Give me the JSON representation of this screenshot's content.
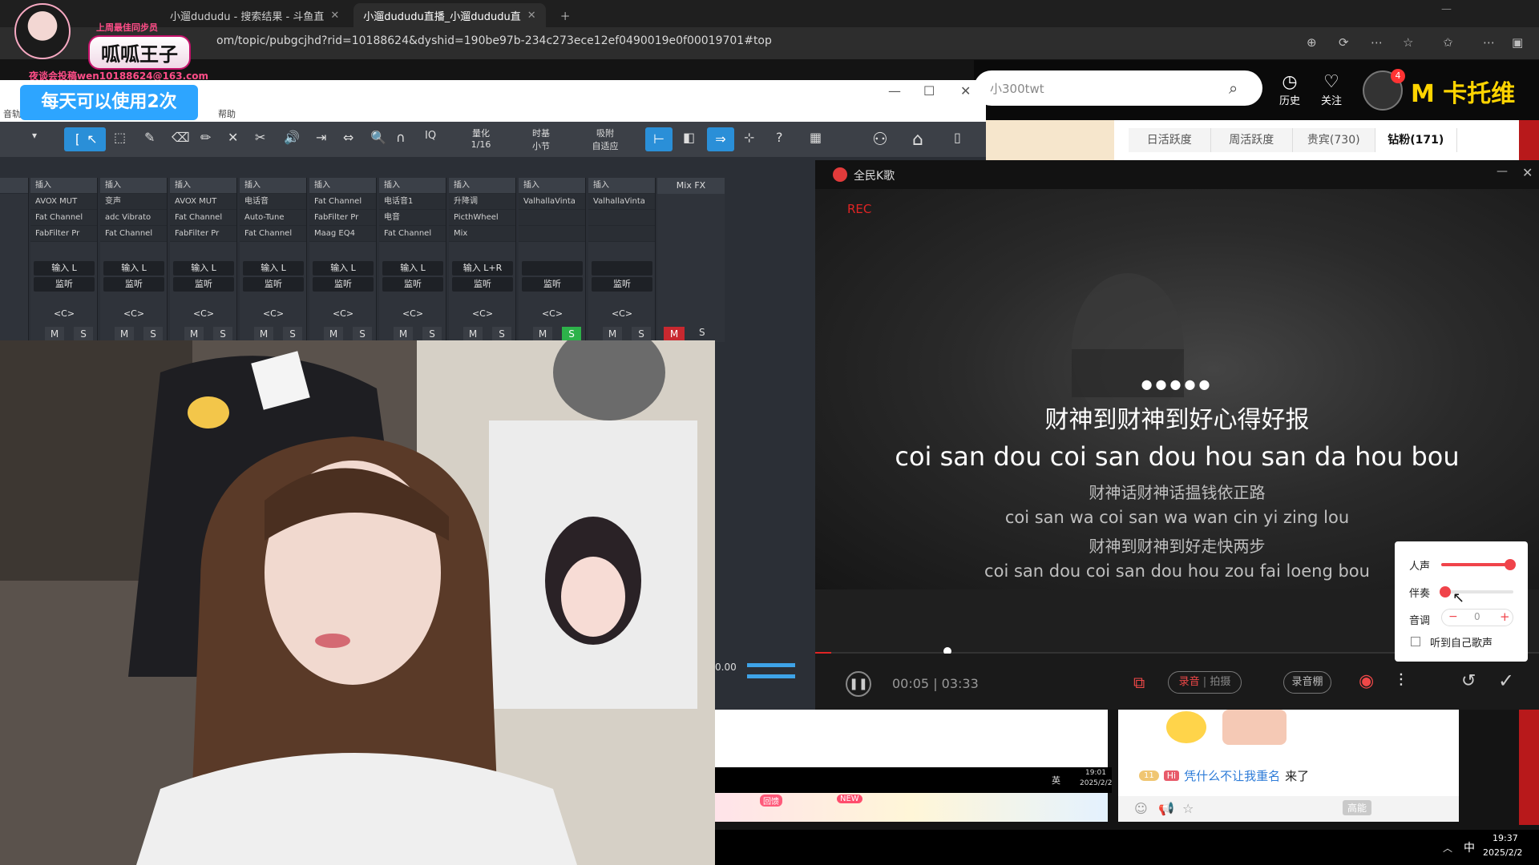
{
  "browser": {
    "tabs": [
      {
        "title": "小遛dududu - 搜索结果 - 斗鱼直"
      },
      {
        "title": "小遛dududu直播_小遛dududu直"
      }
    ],
    "url": "om/topic/pubgcjhd?rid=10188624&dyshid=190be97b-234c273ece12ef0490019e0f00019701#top"
  },
  "watermark": {
    "name": "呱呱王子",
    "subtitle": "上周最佳同步员",
    "email": "夜谈会投稿wen10188624@163.com"
  },
  "site_header": {
    "search_placeholder": "小300twt",
    "history": "历史",
    "follow": "关注",
    "avatar_badge": "4",
    "username": "M 卡托维"
  },
  "rank_tabs": [
    "日活跃度",
    "周活跃度",
    "贵宾(730)",
    "钻粉(171)"
  ],
  "daw": {
    "banner": "每天可以使用2次",
    "menu": [
      "音轨",
      "帮助"
    ],
    "toolbar": {
      "quantize_label": "量化",
      "quantize_value": "1/16",
      "timebase_label": "时基",
      "timebase_value": "小节",
      "snap_label": "吸附",
      "snap_value": "自适应"
    },
    "strips": [
      {
        "ins": "插入",
        "slots": [
          "AVOX MUT",
          "Fat Channel",
          "FabFilter Pr"
        ],
        "io": "输入 L",
        "mon": "监听",
        "pan": "<C>",
        "m": "M",
        "s": "S"
      },
      {
        "ins": "插入",
        "slots": [
          "变声",
          "adc Vibrato",
          "Fat Channel"
        ],
        "io": "输入 L",
        "mon": "监听",
        "pan": "<C>",
        "m": "M",
        "s": "S"
      },
      {
        "ins": "插入",
        "slots": [
          "AVOX MUT",
          "Fat Channel",
          "FabFilter Pr"
        ],
        "io": "输入 L",
        "mon": "监听",
        "pan": "<C>",
        "m": "M",
        "s": "S"
      },
      {
        "ins": "插入",
        "slots": [
          "电话音",
          "Auto-Tune",
          "Fat Channel"
        ],
        "io": "输入 L",
        "mon": "监听",
        "pan": "<C>",
        "m": "M",
        "s": "S"
      },
      {
        "ins": "插入",
        "slots": [
          "Fat Channel",
          "FabFilter Pr",
          "Maag EQ4"
        ],
        "io": "输入 L",
        "mon": "监听",
        "pan": "<C>",
        "m": "M",
        "s": "S"
      },
      {
        "ins": "插入",
        "slots": [
          "电话音1",
          "电音",
          "Fat Channel"
        ],
        "io": "输入 L",
        "mon": "监听",
        "pan": "<C>",
        "m": "M",
        "s": "S"
      },
      {
        "ins": "插入",
        "slots": [
          "升降调",
          "PicthWheel",
          "Mix"
        ],
        "io": "输入 L+R",
        "mon": "监听",
        "pan": "<C>",
        "m": "M",
        "s": "S"
      },
      {
        "ins": "插入",
        "slots": [
          "ValhallaVinta",
          "",
          " "
        ],
        "io": "",
        "mon": "监听",
        "pan": "<C>",
        "m": "M",
        "s": "S"
      },
      {
        "ins": "插入",
        "slots": [
          "ValhallaVinta",
          "",
          ""
        ],
        "io": "",
        "mon": "监听",
        "pan": "<C>",
        "m": "M",
        "s": "S"
      }
    ],
    "mixfx": "Mix FX",
    "master_m": "M",
    "master_s": "S",
    "time_readout": "0.00"
  },
  "karaoke": {
    "app_title": "全民K歌",
    "rec": "REC",
    "dots": "●●●●●",
    "line1_cn": "财神到财神到好心得好报",
    "line1_py": "coi san dou coi san dou hou san da hou bou",
    "line2_cn": "财神话财神话揾钱依正路",
    "line2_py": "coi san wa coi san wa wan cin yi zing lou",
    "line3_cn": "财神到财神到好走快两步",
    "line3_py": "coi san dou coi san dou hou zou fai loeng bou",
    "time": "00:05 | 03:33",
    "record_btn": "录音",
    "shoot_btn": "拍摄",
    "studio_btn": "录音棚",
    "volume": {
      "vocal_label": "人声",
      "vocal_level": 0.95,
      "accomp_label": "伴奏",
      "accomp_level": 0.05,
      "pitch_label": "音调",
      "pitch_value": "0",
      "minus": "−",
      "plus": "+",
      "hear_self": "听到自己歌声"
    }
  },
  "chat": {
    "user": "凭什么不让我重名",
    "action": "来了",
    "level_badge": "11",
    "tag": "Hi",
    "bottom_icon_label": "高能"
  },
  "tray": {
    "inner_time": "19:01",
    "inner_date": "2025/2/2",
    "inner_ime": "英",
    "time": "19:37",
    "date": "2025/2/2",
    "ime": "中",
    "new_badge": "NEW",
    "hui_badge": "回馈"
  },
  "colors": {
    "accent_blue": "#2a8fd8",
    "rec_red": "#e02424",
    "slider_red": "#f0434a",
    "solo_green": "#2db24a",
    "username_yellow": "#ffd400"
  }
}
